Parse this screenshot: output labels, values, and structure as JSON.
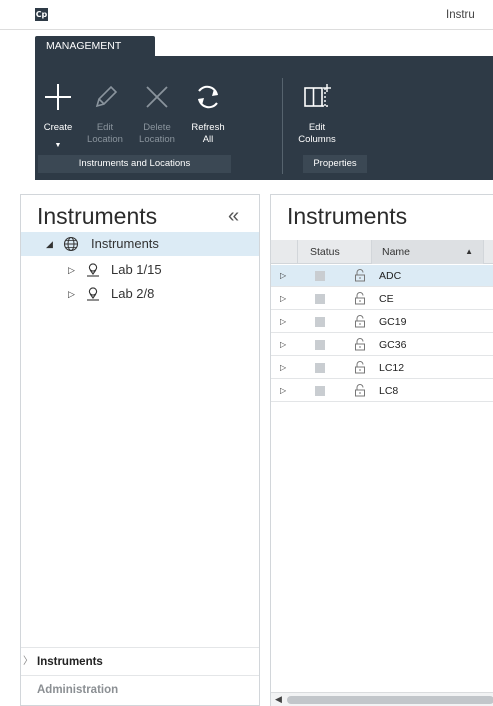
{
  "app": {
    "logo_text": "Cp",
    "window_title": "Instru"
  },
  "ribbon": {
    "tab_label": "MANAGEMENT",
    "buttons": {
      "create": "Create",
      "edit_location": "Edit\nLocation",
      "delete_location": "Delete\nLocation",
      "refresh_all": "Refresh\nAll",
      "edit_columns": "Edit\nColumns"
    },
    "groups": {
      "instruments_locations": "Instruments and Locations",
      "properties": "Properties"
    }
  },
  "left_panel": {
    "title": "Instruments",
    "collapse_glyph": "«",
    "tree": {
      "root": "Instruments",
      "children": [
        "Lab 1/15",
        "Lab 2/8"
      ]
    },
    "nav": {
      "instruments": "Instruments",
      "administration": "Administration"
    }
  },
  "right_panel": {
    "title": "Instruments",
    "columns": {
      "status": "Status",
      "name": "Name"
    },
    "rows": [
      "ADC",
      "CE",
      "GC19",
      "GC36",
      "LC12",
      "LC8"
    ]
  },
  "colors": {
    "ribbon_bg": "#2e3a46",
    "selection": "#dcebf5"
  }
}
